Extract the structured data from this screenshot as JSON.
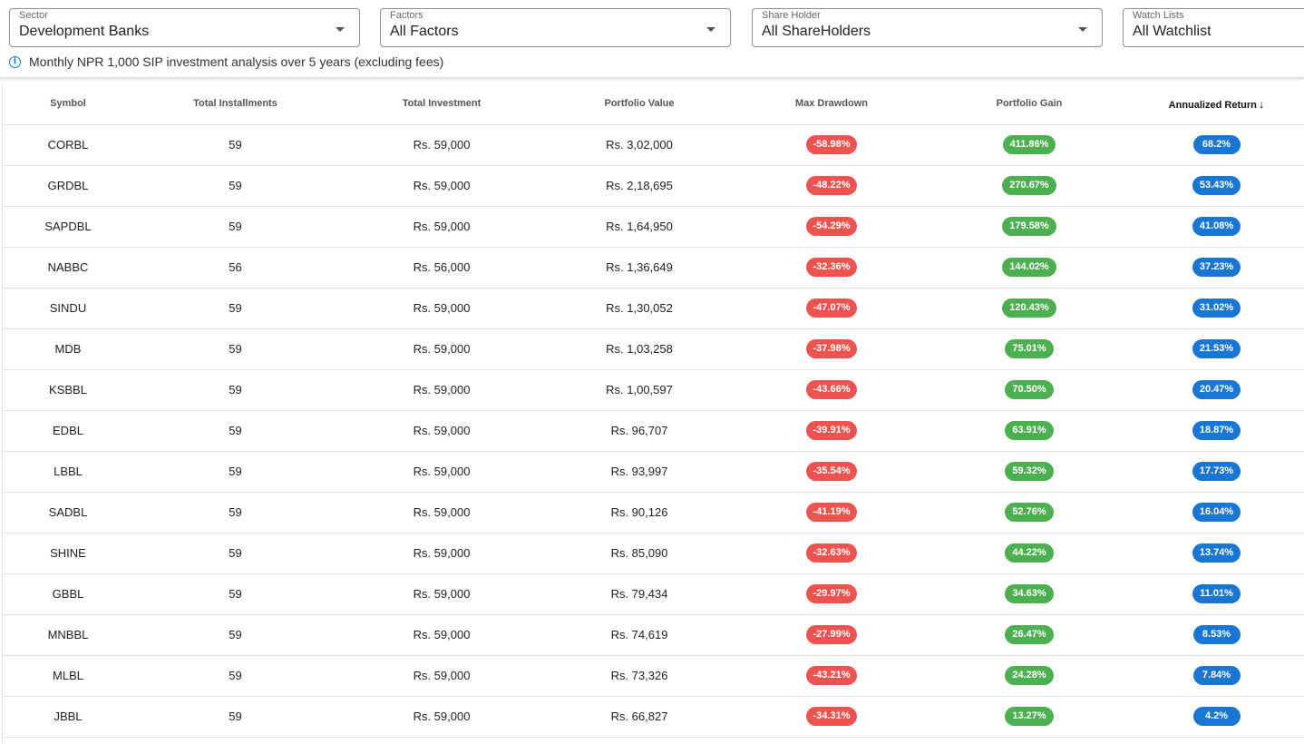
{
  "filters": {
    "sector": {
      "label": "Sector",
      "value": "Development Banks"
    },
    "factors": {
      "label": "Factors",
      "value": "All Factors"
    },
    "shareholder": {
      "label": "Share Holder",
      "value": "All ShareHolders"
    },
    "watchlist": {
      "label": "Watch Lists",
      "value": "All Watchlist"
    }
  },
  "info": "Monthly NPR 1,000 SIP investment analysis over 5 years (excluding fees)",
  "table": {
    "headers": [
      "Symbol",
      "Total Installments",
      "Total Investment",
      "Portfolio Value",
      "Max Drawdown",
      "Portfolio Gain",
      "Annualized Return"
    ],
    "sort_arrow": "↓",
    "colors": {
      "drawdown": "#ef5350",
      "gain": "#4caf50",
      "return": "#1976d2"
    },
    "rows": [
      {
        "symbol": "CORBL",
        "installments": "59",
        "investment": "Rs. 59,000",
        "value": "Rs. 3,02,000",
        "drawdown": "-58.98%",
        "gain": "411.86%",
        "annual": "68.2%"
      },
      {
        "symbol": "GRDBL",
        "installments": "59",
        "investment": "Rs. 59,000",
        "value": "Rs. 2,18,695",
        "drawdown": "-48.22%",
        "gain": "270.67%",
        "annual": "53.43%"
      },
      {
        "symbol": "SAPDBL",
        "installments": "59",
        "investment": "Rs. 59,000",
        "value": "Rs. 1,64,950",
        "drawdown": "-54.29%",
        "gain": "179.58%",
        "annual": "41.08%"
      },
      {
        "symbol": "NABBC",
        "installments": "56",
        "investment": "Rs. 56,000",
        "value": "Rs. 1,36,649",
        "drawdown": "-32.36%",
        "gain": "144.02%",
        "annual": "37.23%"
      },
      {
        "symbol": "SINDU",
        "installments": "59",
        "investment": "Rs. 59,000",
        "value": "Rs. 1,30,052",
        "drawdown": "-47.07%",
        "gain": "120.43%",
        "annual": "31.02%"
      },
      {
        "symbol": "MDB",
        "installments": "59",
        "investment": "Rs. 59,000",
        "value": "Rs. 1,03,258",
        "drawdown": "-37.98%",
        "gain": "75.01%",
        "annual": "21.53%"
      },
      {
        "symbol": "KSBBL",
        "installments": "59",
        "investment": "Rs. 59,000",
        "value": "Rs. 1,00,597",
        "drawdown": "-43.66%",
        "gain": "70.50%",
        "annual": "20.47%"
      },
      {
        "symbol": "EDBL",
        "installments": "59",
        "investment": "Rs. 59,000",
        "value": "Rs. 96,707",
        "drawdown": "-39.91%",
        "gain": "63.91%",
        "annual": "18.87%"
      },
      {
        "symbol": "LBBL",
        "installments": "59",
        "investment": "Rs. 59,000",
        "value": "Rs. 93,997",
        "drawdown": "-35.54%",
        "gain": "59.32%",
        "annual": "17.73%"
      },
      {
        "symbol": "SADBL",
        "installments": "59",
        "investment": "Rs. 59,000",
        "value": "Rs. 90,126",
        "drawdown": "-41.19%",
        "gain": "52.76%",
        "annual": "16.04%"
      },
      {
        "symbol": "SHINE",
        "installments": "59",
        "investment": "Rs. 59,000",
        "value": "Rs. 85,090",
        "drawdown": "-32.63%",
        "gain": "44.22%",
        "annual": "13.74%"
      },
      {
        "symbol": "GBBL",
        "installments": "59",
        "investment": "Rs. 59,000",
        "value": "Rs. 79,434",
        "drawdown": "-29.97%",
        "gain": "34.63%",
        "annual": "11.01%"
      },
      {
        "symbol": "MNBBL",
        "installments": "59",
        "investment": "Rs. 59,000",
        "value": "Rs. 74,619",
        "drawdown": "-27.99%",
        "gain": "26.47%",
        "annual": "8.53%"
      },
      {
        "symbol": "MLBL",
        "installments": "59",
        "investment": "Rs. 59,000",
        "value": "Rs. 73,326",
        "drawdown": "-43.21%",
        "gain": "24.28%",
        "annual": "7.84%"
      },
      {
        "symbol": "JBBL",
        "installments": "59",
        "investment": "Rs. 59,000",
        "value": "Rs. 66,827",
        "drawdown": "-34.31%",
        "gain": "13.27%",
        "annual": "4.2%"
      }
    ]
  }
}
